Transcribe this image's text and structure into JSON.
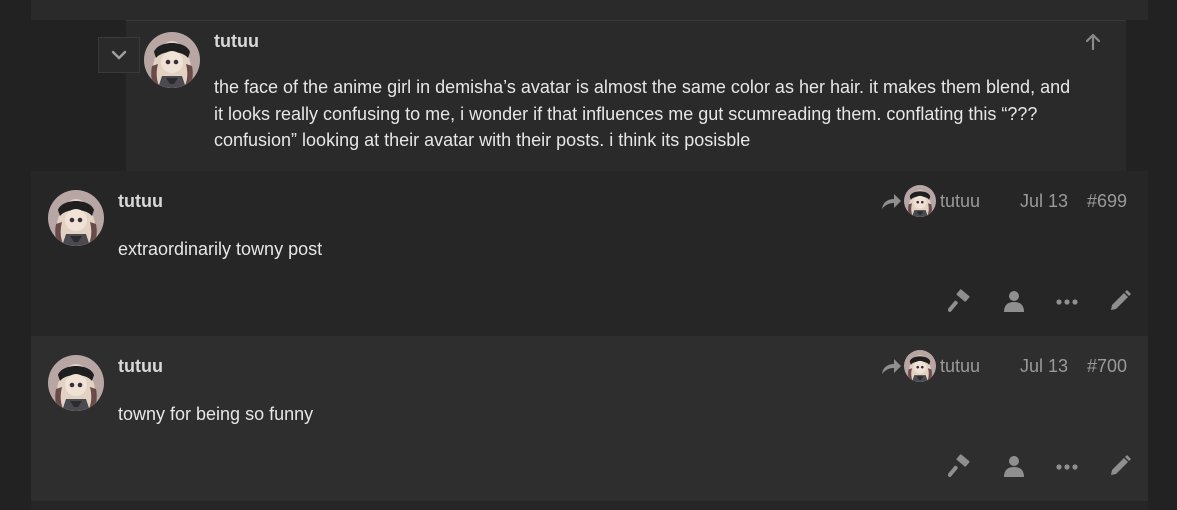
{
  "quoted": {
    "username": "tutuu",
    "lines": [
      "the face of the anime girl in demisha’s avatar is almost the same color as her hair. it makes them blend, and",
      "it looks really confusing to me, i wonder if that influences me gut scumreading them. conflating this “???",
      "confusion” looking at their avatar with their posts. i think its posisble"
    ]
  },
  "posts": [
    {
      "username": "tutuu",
      "reply_to": "tutuu",
      "date": "Jul 13",
      "number": "#699",
      "body": "extraordinarily towny post"
    },
    {
      "username": "tutuu",
      "reply_to": "tutuu",
      "date": "Jul 13",
      "number": "#700",
      "body": "towny for being so funny"
    }
  ],
  "icons": {
    "collapse": "chevron-down-icon",
    "jump_up": "arrow-up-icon",
    "reply": "reply-arrow-icon",
    "moderate": "hammer-icon",
    "user": "user-icon",
    "more": "ellipsis-icon",
    "edit": "pencil-icon"
  },
  "colors": {
    "background": "#222222",
    "post_bg_a": "#262626",
    "post_bg_b": "#2e2e2e",
    "muted_text": "#9a9a9a",
    "icon_color": "#8f8f8f"
  }
}
